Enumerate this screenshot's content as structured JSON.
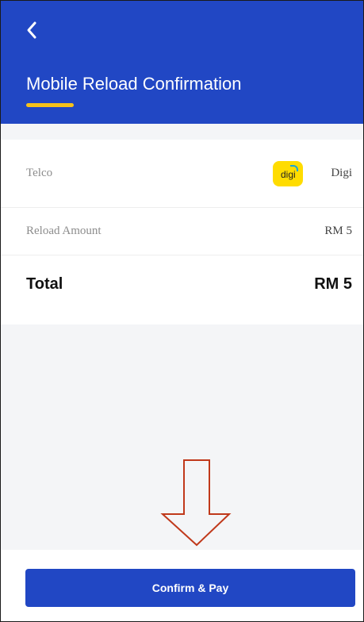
{
  "header": {
    "back_icon": "chevron-left-icon",
    "title": "Mobile Reload Confirmation",
    "background_color": "#2147c4",
    "accent_color": "#f6c21a"
  },
  "details": {
    "telco": {
      "label": "Telco",
      "logo_text": "digi",
      "value": "Digi"
    },
    "reload_amount": {
      "label": "Reload Amount",
      "value": "RM 5"
    },
    "total": {
      "label": "Total",
      "value": "RM 5"
    }
  },
  "annotation": {
    "icon": "down-arrow-icon",
    "color": "#c0391b"
  },
  "footer": {
    "confirm_label": "Confirm & Pay"
  }
}
